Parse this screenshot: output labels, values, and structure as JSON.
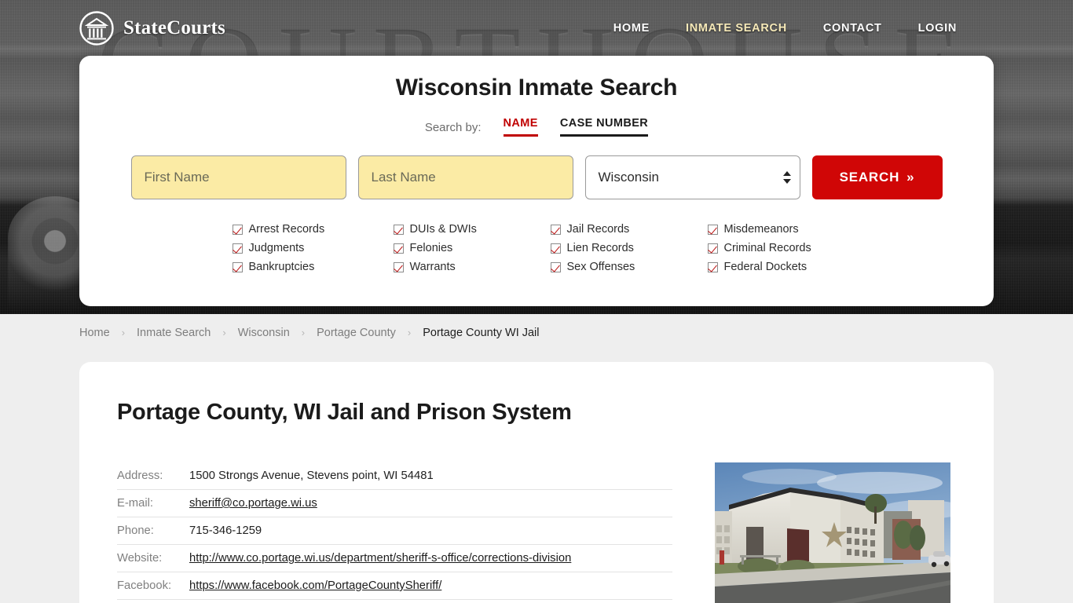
{
  "header": {
    "brand_name": "StateCourts",
    "brand_icon": "courthouse-circle-icon",
    "nav": [
      {
        "label": "HOME",
        "active": false
      },
      {
        "label": "INMATE SEARCH",
        "active": true
      },
      {
        "label": "CONTACT",
        "active": false
      },
      {
        "label": "LOGIN",
        "active": false
      }
    ],
    "hero_watermark": "COURTHOUSE"
  },
  "search": {
    "title": "Wisconsin Inmate Search",
    "search_by_label": "Search by:",
    "tabs": [
      {
        "label": "NAME",
        "active": true
      },
      {
        "label": "CASE NUMBER",
        "active": false
      }
    ],
    "first_name_placeholder": "First Name",
    "first_name_value": "",
    "last_name_placeholder": "Last Name",
    "last_name_value": "",
    "state_selected": "Wisconsin",
    "submit_label": "SEARCH",
    "submit_chevron": "»",
    "accent_red": "#d00606",
    "field_highlight": "#fbeba5",
    "record_types": [
      "Arrest Records",
      "DUIs & DWIs",
      "Jail Records",
      "Misdemeanors",
      "Judgments",
      "Felonies",
      "Lien Records",
      "Criminal Records",
      "Bankruptcies",
      "Warrants",
      "Sex Offenses",
      "Federal Dockets"
    ]
  },
  "breadcrumb": {
    "separator": "›",
    "items": [
      {
        "label": "Home",
        "current": false
      },
      {
        "label": "Inmate Search",
        "current": false
      },
      {
        "label": "Wisconsin",
        "current": false
      },
      {
        "label": "Portage County",
        "current": false
      },
      {
        "label": "Portage County WI Jail",
        "current": true
      }
    ]
  },
  "main": {
    "page_title": "Portage County, WI Jail and Prison System",
    "details": [
      {
        "label": "Address:",
        "value": "1500 Strongs Avenue, Stevens point, WI 54481",
        "link": false
      },
      {
        "label": "E-mail:",
        "value": "sheriff@co.portage.wi.us",
        "link": true
      },
      {
        "label": "Phone:",
        "value": "715-346-1259",
        "link": false
      },
      {
        "label": "Website:",
        "value": "http://www.co.portage.wi.us/department/sheriff-s-office/corrections-division",
        "link": true
      },
      {
        "label": "Facebook:",
        "value": "https://www.facebook.com/PortageCountySheriff/",
        "link": true
      }
    ],
    "photo_alt": "jail-building-photo"
  }
}
